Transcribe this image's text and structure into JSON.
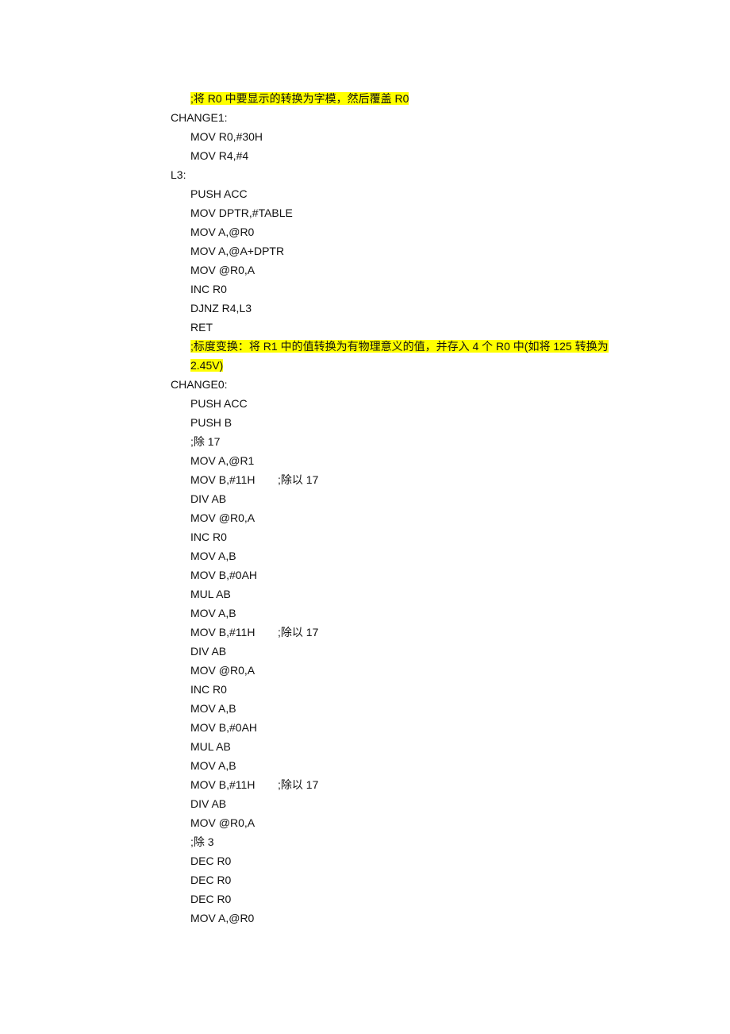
{
  "highlight_color": "#ffff00",
  "lines": [
    {
      "text": ";将 R0 中要显示的转换为字模，然后覆盖 R0",
      "indent": true,
      "highlight": true
    },
    {
      "text": "CHANGE1:",
      "indent": false
    },
    {
      "text": "MOV R0,#30H",
      "indent": true
    },
    {
      "text": "MOV R4,#4",
      "indent": true
    },
    {
      "text": "L3:",
      "indent": false
    },
    {
      "text": "PUSH ACC",
      "indent": true
    },
    {
      "text": "MOV DPTR,#TABLE",
      "indent": true
    },
    {
      "text": "MOV A,@R0",
      "indent": true
    },
    {
      "text": "MOV A,@A+DPTR",
      "indent": true
    },
    {
      "text": "MOV @R0,A",
      "indent": true
    },
    {
      "text": "INC R0",
      "indent": true
    },
    {
      "text": "DJNZ R4,L3",
      "indent": true
    },
    {
      "text": "RET",
      "indent": true
    },
    {
      "text": ";标度变换：将 R1 中的值转换为有物理意义的值，并存入 4 个 R0 中(如将 125 转换为 2.45V)",
      "indent": true,
      "highlight": true,
      "wrap": true
    },
    {
      "text": "CHANGE0:",
      "indent": false
    },
    {
      "text": "PUSH ACC",
      "indent": true
    },
    {
      "text": "PUSH B",
      "indent": true
    },
    {
      "text": ";除 17",
      "indent": true
    },
    {
      "text": "MOV A,@R1",
      "indent": true
    },
    {
      "text": "MOV B,#11H",
      "indent": true,
      "comment": ";除以 17"
    },
    {
      "text": "DIV AB",
      "indent": true
    },
    {
      "text": "MOV @R0,A",
      "indent": true
    },
    {
      "text": "INC R0",
      "indent": true
    },
    {
      "text": "MOV A,B",
      "indent": true
    },
    {
      "text": "MOV B,#0AH",
      "indent": true
    },
    {
      "text": "MUL AB",
      "indent": true
    },
    {
      "text": "MOV A,B",
      "indent": true
    },
    {
      "text": "MOV B,#11H",
      "indent": true,
      "comment": ";除以 17"
    },
    {
      "text": "DIV AB",
      "indent": true
    },
    {
      "text": "MOV @R0,A",
      "indent": true
    },
    {
      "text": "INC R0",
      "indent": true
    },
    {
      "text": "MOV A,B",
      "indent": true
    },
    {
      "text": "MOV B,#0AH",
      "indent": true
    },
    {
      "text": "MUL AB",
      "indent": true
    },
    {
      "text": "MOV A,B",
      "indent": true
    },
    {
      "text": "MOV B,#11H",
      "indent": true,
      "comment": ";除以 17"
    },
    {
      "text": "DIV AB",
      "indent": true
    },
    {
      "text": "MOV @R0,A",
      "indent": true
    },
    {
      "text": ";除 3",
      "indent": true
    },
    {
      "text": "DEC R0",
      "indent": true
    },
    {
      "text": "DEC R0",
      "indent": true
    },
    {
      "text": "DEC R0",
      "indent": true
    },
    {
      "text": "MOV A,@R0",
      "indent": true
    }
  ]
}
